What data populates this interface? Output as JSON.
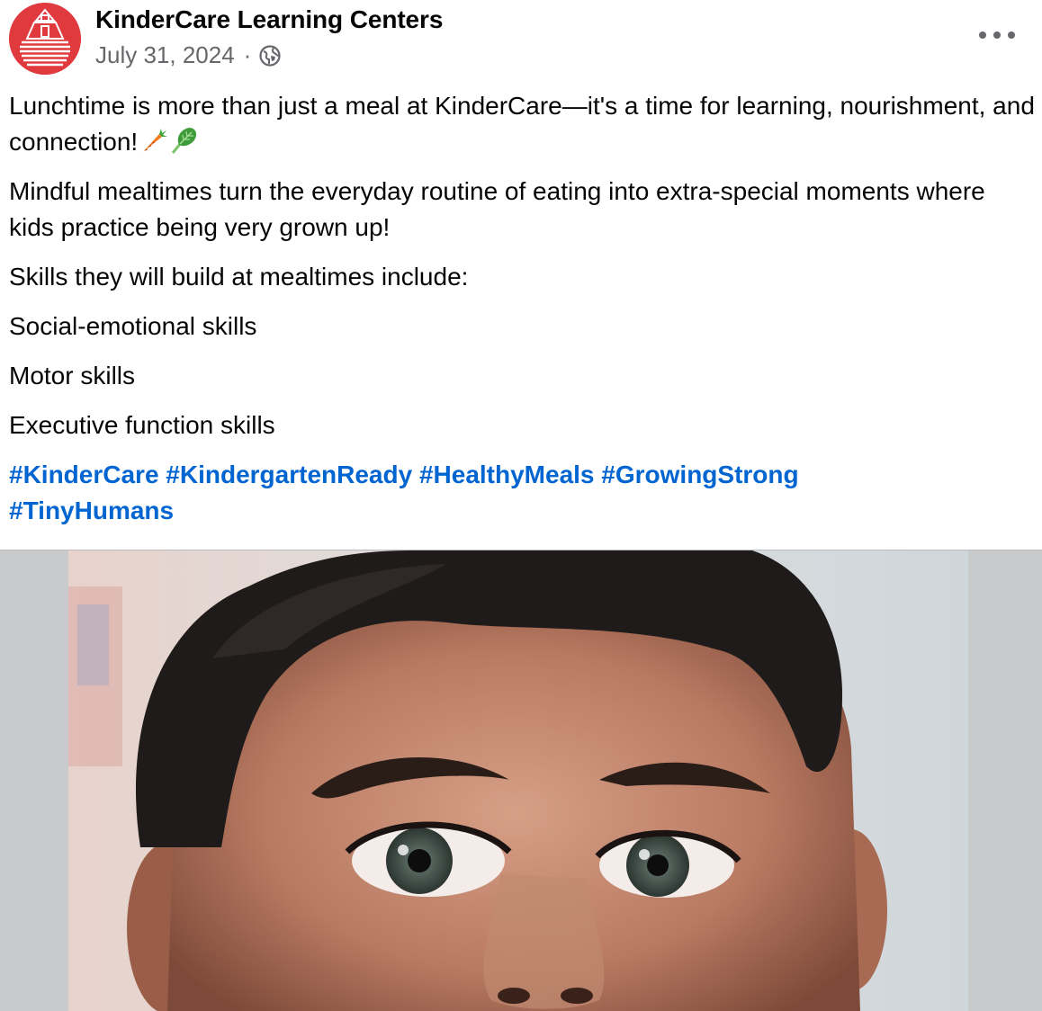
{
  "post": {
    "author": "KinderCare Learning Centers",
    "date": "July 31, 2024",
    "separator": "·",
    "audience_icon": "globe-icon",
    "more_icon": "more-options-icon",
    "paragraphs": [
      "Lunchtime is more than just a meal at KinderCare—it's a time for learning, nourishment, and connection!",
      "Mindful mealtimes turn the everyday routine of eating into extra-special moments where kids practice being very grown up!",
      "Skills they will build at mealtimes include:",
      "Social-emotional skills",
      "Motor skills",
      "Executive function skills"
    ],
    "paragraph_emojis": [
      "carrot-emoji",
      "leafy-green-emoji"
    ],
    "hashtags": [
      "#KinderCare",
      "#KindergartenReady",
      "#HealthyMeals",
      "#GrowingStrong",
      "#TinyHumans"
    ]
  },
  "colors": {
    "brand_red": "#e03a3e",
    "link_blue": "#0064d1",
    "meta_gray": "#65676b",
    "photo_background": "#c9cacc"
  }
}
